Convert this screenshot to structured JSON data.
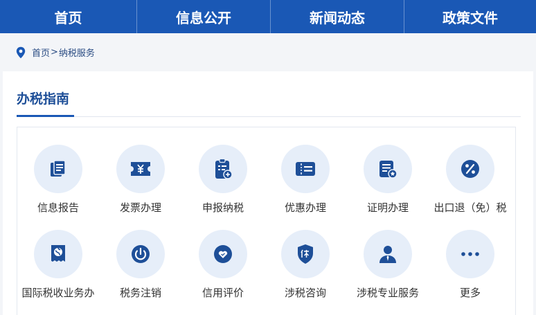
{
  "nav": {
    "items": [
      {
        "label": "首页"
      },
      {
        "label": "信息公开"
      },
      {
        "label": "新闻动态"
      },
      {
        "label": "政策文件"
      }
    ]
  },
  "breadcrumb": {
    "home": "首页",
    "separator": ">",
    "current": "纳税服务"
  },
  "section": {
    "title": "办税指南"
  },
  "services": [
    {
      "label": "信息报告",
      "icon": "document-stack-icon"
    },
    {
      "label": "发票办理",
      "icon": "invoice-yen-icon"
    },
    {
      "label": "申报纳税",
      "icon": "clipboard-declare-icon"
    },
    {
      "label": "优惠办理",
      "icon": "coupon-icon"
    },
    {
      "label": "证明办理",
      "icon": "certificate-icon"
    },
    {
      "label": "出口退（免）税",
      "icon": "percent-icon"
    },
    {
      "label": "国际税收业务办",
      "icon": "globe-document-icon"
    },
    {
      "label": "税务注销",
      "icon": "power-icon"
    },
    {
      "label": "信用评价",
      "icon": "credit-heart-icon"
    },
    {
      "label": "涉税咨询",
      "icon": "shield-bao-icon"
    },
    {
      "label": "涉税专业服务",
      "icon": "person-icon"
    },
    {
      "label": "更多",
      "icon": "more-dots-icon"
    }
  ],
  "colors": {
    "nav_bg": "#1a58b5",
    "accent": "#1a58b5",
    "circle_bg": "#e6eef9",
    "icon_dark": "#1e4f98"
  }
}
